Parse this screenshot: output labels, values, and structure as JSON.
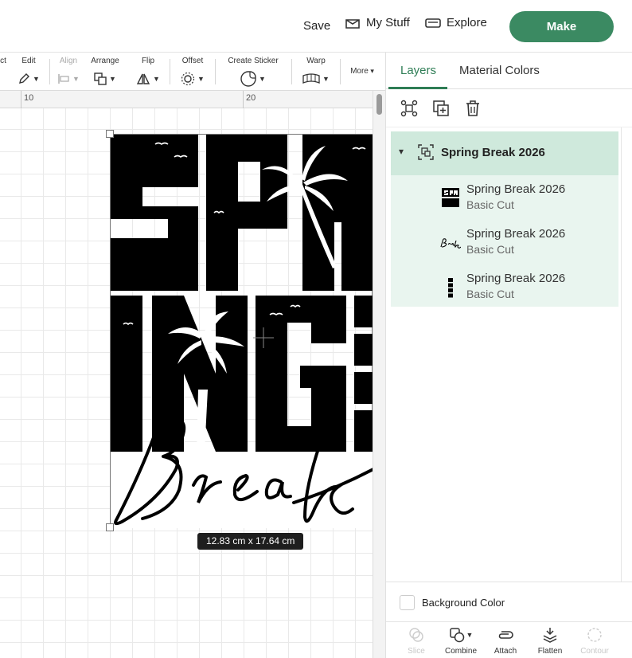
{
  "header": {
    "save_label": "Save",
    "mystuff_label": "My Stuff",
    "explore_label": "Explore",
    "make_label": "Make"
  },
  "toolbar": {
    "partial_label": "ct",
    "edit_label": "Edit",
    "align_label": "Align",
    "arrange_label": "Arrange",
    "flip_label": "Flip",
    "offset_label": "Offset",
    "sticker_label": "Create Sticker",
    "warp_label": "Warp",
    "more_label": "More"
  },
  "ruler": {
    "marks": [
      "10",
      "20"
    ]
  },
  "canvas": {
    "dimensions": "12.83  cm x 17.64  cm"
  },
  "panel": {
    "tabs": [
      "Layers",
      "Material Colors"
    ],
    "group_name": "Spring Break 2026",
    "layers": [
      {
        "name": "Spring Break 2026",
        "type": "Basic Cut"
      },
      {
        "name": "Spring Break 2026",
        "type": "Basic Cut"
      },
      {
        "name": "Spring Break 2026",
        "type": "Basic Cut"
      }
    ],
    "background_color_label": "Background Color",
    "bottom_tools": {
      "slice": "Slice",
      "combine": "Combine",
      "attach": "Attach",
      "flatten": "Flatten",
      "contour": "Contour"
    }
  },
  "colors": {
    "accent": "#3b8a62",
    "accent_text": "#2e7d55",
    "layers_bg": "#e9f5ef",
    "group_bg": "#cfe9dc"
  }
}
